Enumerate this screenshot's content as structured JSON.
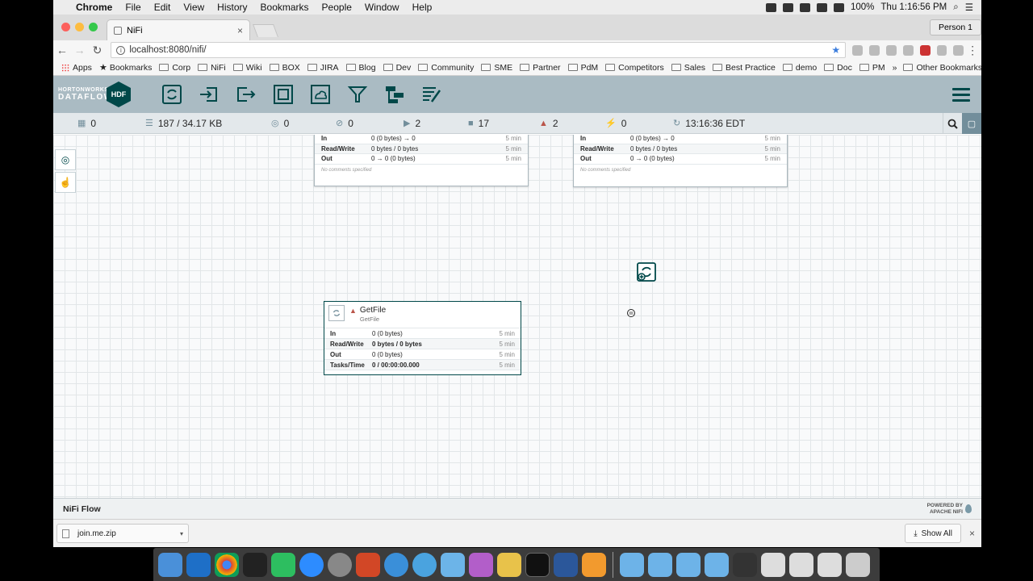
{
  "menubar": {
    "app": "Chrome",
    "items": [
      "File",
      "Edit",
      "View",
      "History",
      "Bookmarks",
      "People",
      "Window",
      "Help"
    ],
    "battery": "100%",
    "clock": "Thu 1:16:56 PM"
  },
  "browser": {
    "tab_title": "NiFi",
    "tab_close": "×",
    "person": "Person 1",
    "url": "localhost:8080/nifi/",
    "bookmarks": [
      "Apps",
      "Bookmarks",
      "Corp",
      "NiFi",
      "Wiki",
      "BOX",
      "JIRA",
      "Blog",
      "Dev",
      "Community",
      "SME",
      "Partner",
      "PdM",
      "Competitors",
      "Sales",
      "Best Practice",
      "demo",
      "Doc",
      "PM"
    ],
    "other_bookmarks": "Other Bookmarks",
    "overflow": "»"
  },
  "nifi": {
    "logo_top": "HORTONWORKS",
    "logo_bottom": "DATAFLOW",
    "hdf": "HDF",
    "components": [
      "processor-icon",
      "input-port-icon",
      "output-port-icon",
      "process-group-icon",
      "remote-process-group-icon",
      "funnel-icon",
      "template-icon",
      "label-icon"
    ],
    "status": {
      "transmitting": "0",
      "queued": "187 / 34.17 KB",
      "not_transmitting": "0",
      "disabled": "0",
      "running": "2",
      "stopped": "17",
      "invalid": "2",
      "disabled_components": "0",
      "refreshed": "13:16:36 EDT"
    },
    "group_left": {
      "rows": [
        {
          "k": "In",
          "v": "0 (0 bytes) → 0",
          "t": "5 min"
        },
        {
          "k": "Read/Write",
          "v": "0 bytes / 0 bytes",
          "t": "5 min"
        },
        {
          "k": "Out",
          "v": "0 → 0 (0 bytes)",
          "t": "5 min"
        }
      ],
      "comments": "No comments specified"
    },
    "group_right": {
      "rows": [
        {
          "k": "In",
          "v": "0 (0 bytes) → 0",
          "t": "5 min"
        },
        {
          "k": "Read/Write",
          "v": "0 bytes / 0 bytes",
          "t": "5 min"
        },
        {
          "k": "Out",
          "v": "0 → 0 (0 bytes)",
          "t": "5 min"
        }
      ],
      "comments": "No comments specified"
    },
    "processor": {
      "name": "GetFile",
      "type": "GetFile",
      "rows": [
        {
          "k": "In",
          "v": "0 (0 bytes)",
          "t": "5 min"
        },
        {
          "k": "Read/Write",
          "v": "0 bytes / 0 bytes",
          "t": "5 min"
        },
        {
          "k": "Out",
          "v": "0 (0 bytes)",
          "t": "5 min"
        },
        {
          "k": "Tasks/Time",
          "v": "0 / 00:00:00.000",
          "t": "5 min"
        }
      ]
    },
    "breadcrumb": "NiFi Flow",
    "powered_by_1": "POWERED BY",
    "powered_by_2": "APACHE NIFI"
  },
  "downloads": {
    "file": "join.me.zip",
    "show_all": "Show All",
    "close": "×"
  },
  "colors": {
    "nifi_header": "#aabbc3",
    "nifi_teal": "#004849",
    "status_bg": "#e3e8eb",
    "warning_red": "#ba554a"
  }
}
